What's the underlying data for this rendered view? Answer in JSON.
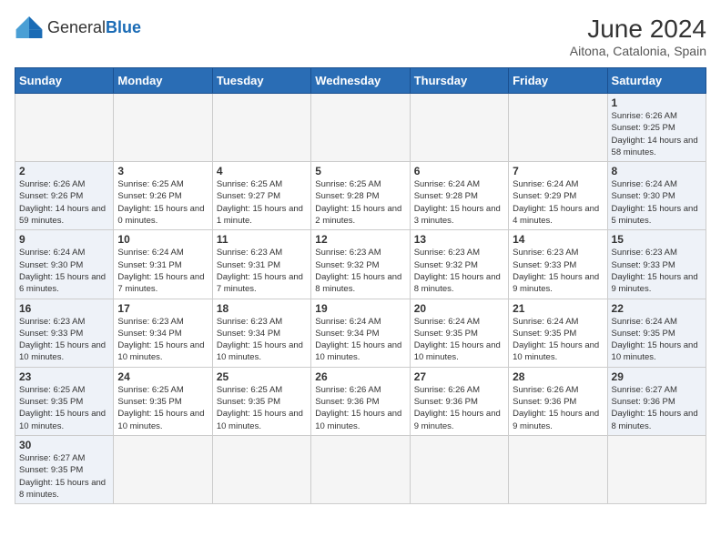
{
  "header": {
    "logo_general": "General",
    "logo_blue": "Blue",
    "title": "June 2024",
    "subtitle": "Aitona, Catalonia, Spain"
  },
  "columns": [
    "Sunday",
    "Monday",
    "Tuesday",
    "Wednesday",
    "Thursday",
    "Friday",
    "Saturday"
  ],
  "days": {
    "d1": {
      "num": "1",
      "sunrise": "6:26 AM",
      "sunset": "9:25 PM",
      "daylight": "14 hours and 58 minutes."
    },
    "d2": {
      "num": "2",
      "sunrise": "6:26 AM",
      "sunset": "9:26 PM",
      "daylight": "14 hours and 59 minutes."
    },
    "d3": {
      "num": "3",
      "sunrise": "6:25 AM",
      "sunset": "9:26 PM",
      "daylight": "15 hours and 0 minutes."
    },
    "d4": {
      "num": "4",
      "sunrise": "6:25 AM",
      "sunset": "9:27 PM",
      "daylight": "15 hours and 1 minute."
    },
    "d5": {
      "num": "5",
      "sunrise": "6:25 AM",
      "sunset": "9:28 PM",
      "daylight": "15 hours and 2 minutes."
    },
    "d6": {
      "num": "6",
      "sunrise": "6:24 AM",
      "sunset": "9:28 PM",
      "daylight": "15 hours and 3 minutes."
    },
    "d7": {
      "num": "7",
      "sunrise": "6:24 AM",
      "sunset": "9:29 PM",
      "daylight": "15 hours and 4 minutes."
    },
    "d8": {
      "num": "8",
      "sunrise": "6:24 AM",
      "sunset": "9:30 PM",
      "daylight": "15 hours and 5 minutes."
    },
    "d9": {
      "num": "9",
      "sunrise": "6:24 AM",
      "sunset": "9:30 PM",
      "daylight": "15 hours and 6 minutes."
    },
    "d10": {
      "num": "10",
      "sunrise": "6:24 AM",
      "sunset": "9:31 PM",
      "daylight": "15 hours and 7 minutes."
    },
    "d11": {
      "num": "11",
      "sunrise": "6:23 AM",
      "sunset": "9:31 PM",
      "daylight": "15 hours and 7 minutes."
    },
    "d12": {
      "num": "12",
      "sunrise": "6:23 AM",
      "sunset": "9:32 PM",
      "daylight": "15 hours and 8 minutes."
    },
    "d13": {
      "num": "13",
      "sunrise": "6:23 AM",
      "sunset": "9:32 PM",
      "daylight": "15 hours and 8 minutes."
    },
    "d14": {
      "num": "14",
      "sunrise": "6:23 AM",
      "sunset": "9:33 PM",
      "daylight": "15 hours and 9 minutes."
    },
    "d15": {
      "num": "15",
      "sunrise": "6:23 AM",
      "sunset": "9:33 PM",
      "daylight": "15 hours and 9 minutes."
    },
    "d16": {
      "num": "16",
      "sunrise": "6:23 AM",
      "sunset": "9:33 PM",
      "daylight": "15 hours and 10 minutes."
    },
    "d17": {
      "num": "17",
      "sunrise": "6:23 AM",
      "sunset": "9:34 PM",
      "daylight": "15 hours and 10 minutes."
    },
    "d18": {
      "num": "18",
      "sunrise": "6:23 AM",
      "sunset": "9:34 PM",
      "daylight": "15 hours and 10 minutes."
    },
    "d19": {
      "num": "19",
      "sunrise": "6:24 AM",
      "sunset": "9:34 PM",
      "daylight": "15 hours and 10 minutes."
    },
    "d20": {
      "num": "20",
      "sunrise": "6:24 AM",
      "sunset": "9:35 PM",
      "daylight": "15 hours and 10 minutes."
    },
    "d21": {
      "num": "21",
      "sunrise": "6:24 AM",
      "sunset": "9:35 PM",
      "daylight": "15 hours and 10 minutes."
    },
    "d22": {
      "num": "22",
      "sunrise": "6:24 AM",
      "sunset": "9:35 PM",
      "daylight": "15 hours and 10 minutes."
    },
    "d23": {
      "num": "23",
      "sunrise": "6:25 AM",
      "sunset": "9:35 PM",
      "daylight": "15 hours and 10 minutes."
    },
    "d24": {
      "num": "24",
      "sunrise": "6:25 AM",
      "sunset": "9:35 PM",
      "daylight": "15 hours and 10 minutes."
    },
    "d25": {
      "num": "25",
      "sunrise": "6:25 AM",
      "sunset": "9:35 PM",
      "daylight": "15 hours and 10 minutes."
    },
    "d26": {
      "num": "26",
      "sunrise": "6:26 AM",
      "sunset": "9:36 PM",
      "daylight": "15 hours and 10 minutes."
    },
    "d27": {
      "num": "27",
      "sunrise": "6:26 AM",
      "sunset": "9:36 PM",
      "daylight": "15 hours and 9 minutes."
    },
    "d28": {
      "num": "28",
      "sunrise": "6:26 AM",
      "sunset": "9:36 PM",
      "daylight": "15 hours and 9 minutes."
    },
    "d29": {
      "num": "29",
      "sunrise": "6:27 AM",
      "sunset": "9:36 PM",
      "daylight": "15 hours and 8 minutes."
    },
    "d30": {
      "num": "30",
      "sunrise": "6:27 AM",
      "sunset": "9:35 PM",
      "daylight": "15 hours and 8 minutes."
    }
  }
}
